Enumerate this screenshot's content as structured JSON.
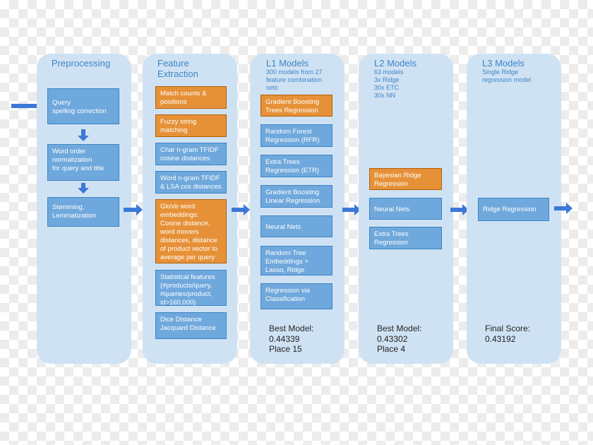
{
  "colors": {
    "column": "#cfe2f3",
    "box_blue": "#6fa8dc",
    "box_orange": "#e69138",
    "title": "#3d85c6",
    "arrow": "#3c78d8"
  },
  "preprocessing": {
    "title": "Preprocessing",
    "steps": [
      "Query\nspelling correction",
      "Word order\nnormalization\nfor query and title",
      "Stemming,\nLemmatization"
    ]
  },
  "feature_extraction": {
    "title": "Feature\nExtraction",
    "items": [
      {
        "label": "Match counts &\npositions",
        "highlight": true
      },
      {
        "label": "Fuzzy string\nmatching",
        "highlight": true
      },
      {
        "label": "Char n-gram TFIDF\ncosine distances",
        "highlight": false
      },
      {
        "label": "Word n-gram TFIDF\n& LSA cos distances",
        "highlight": false
      },
      {
        "label": "GloVe word\nembeddings:\nCosine distance,\nword movers\ndistances, distance\nof product vector to\naverage per query",
        "highlight": true
      },
      {
        "label": "Statistical features\n(#products/query,\n#queries/product,\nid>160,000)",
        "highlight": false
      },
      {
        "label": "Dice Distance\nJacquard Distance",
        "highlight": false
      }
    ]
  },
  "l1": {
    "title": "L1 Models",
    "subtitle": "300 models from 27\nfeature combination\nsets",
    "items": [
      {
        "label": "Gradient Boosting\nTrees Regression",
        "highlight": true
      },
      {
        "label": "Random Forest\nRegression (RFR)",
        "highlight": false
      },
      {
        "label": "Extra Trees\nRegression (ETR)",
        "highlight": false
      },
      {
        "label": "Gradient Boosting\nLinear Regression",
        "highlight": false
      },
      {
        "label": "Neural Nets",
        "highlight": false
      },
      {
        "label": "Random Tree\nEmbeddings +\nLasso, Ridge",
        "highlight": false
      },
      {
        "label": "Regression via\nClassification",
        "highlight": false
      }
    ],
    "result": "Best Model:\n0.44339\nPlace 15"
  },
  "l2": {
    "title": "L2 Models",
    "subtitle": "63 models\n3x Ridge\n30x ETC\n30x NN",
    "items": [
      {
        "label": "Bayesian Ridge\nRegression",
        "highlight": true
      },
      {
        "label": "Neural Nets",
        "highlight": false
      },
      {
        "label": "Extra Trees\nRegression",
        "highlight": false
      }
    ],
    "result": "Best Model:\n0.43302\nPlace 4"
  },
  "l3": {
    "title": "L3 Models",
    "subtitle": "Single Ridge\nregression model",
    "items": [
      {
        "label": "Ridge Regression",
        "highlight": false
      }
    ],
    "result": "Final Score:\n0.43192"
  }
}
